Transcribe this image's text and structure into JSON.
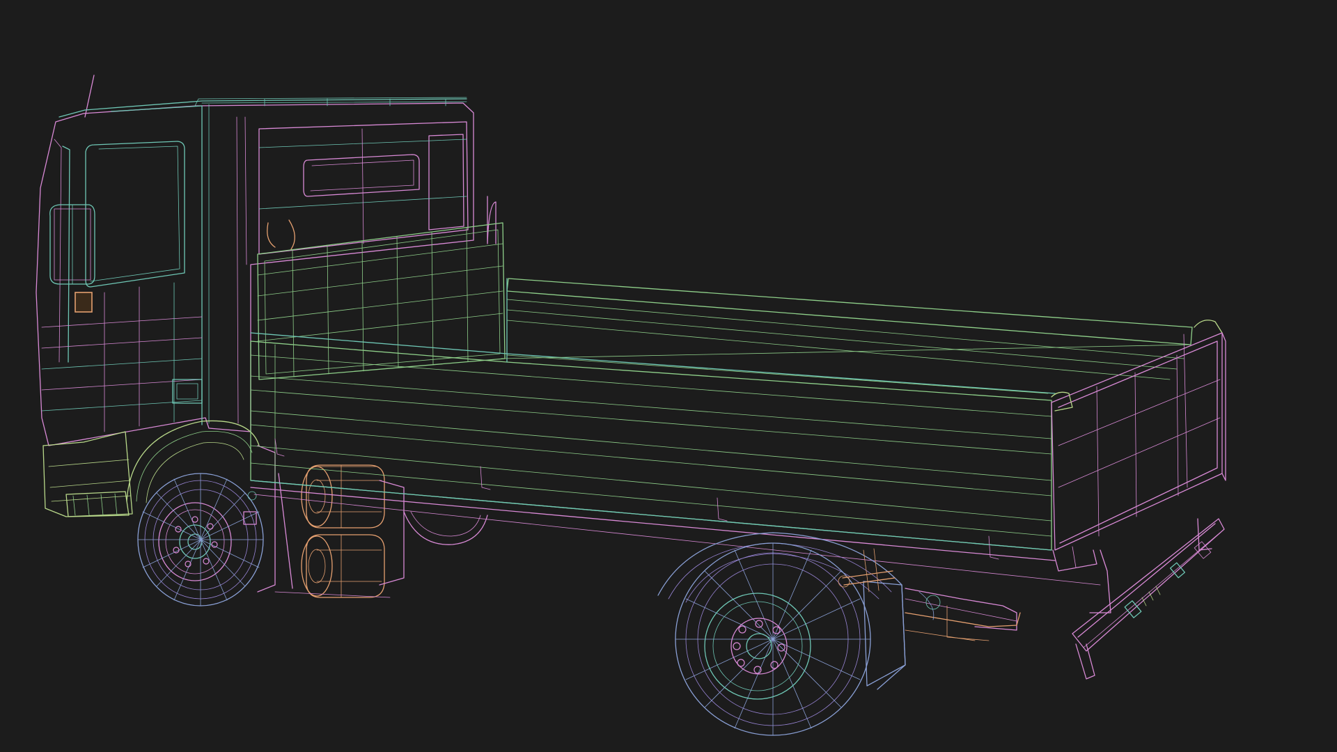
{
  "viewport": {
    "background": "#1c1c1c"
  },
  "palette": {
    "pink": "#d98ad6",
    "teal": "#6fc8b6",
    "green": "#8fd08a",
    "lime": "#b9d98a",
    "orange": "#e5a070",
    "blue": "#8aa0d6",
    "violet": "#9a86d8"
  },
  "scene": {
    "subject": "flatbed-truck-wireframe"
  }
}
